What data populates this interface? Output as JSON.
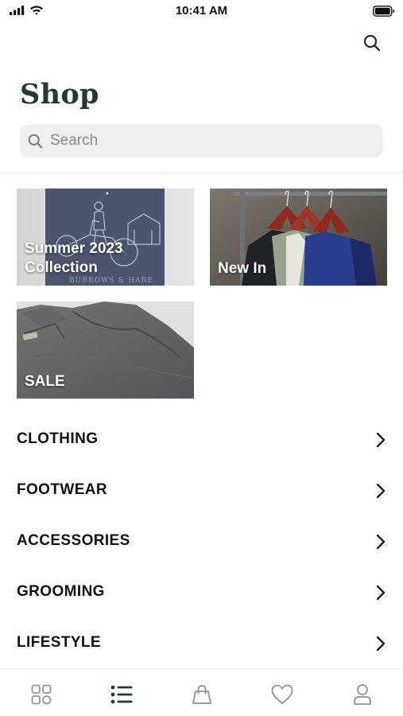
{
  "status_bar": {
    "time": "10:41 AM",
    "icons": [
      "cellular-signal-icon",
      "wifi-icon",
      "battery-icon"
    ]
  },
  "header": {
    "title": "Shop",
    "search_button_icon": "search-icon"
  },
  "search": {
    "placeholder": "Search",
    "value": ""
  },
  "featured_tiles": [
    {
      "label_line1": "Summer 2023",
      "label_line2": "Collection"
    },
    {
      "label": "New In"
    },
    {
      "label": "SALE"
    }
  ],
  "categories": [
    {
      "label": "CLOTHING"
    },
    {
      "label": "FOOTWEAR"
    },
    {
      "label": "ACCESSORIES"
    },
    {
      "label": "GROOMING"
    },
    {
      "label": "LIFESTYLE"
    }
  ],
  "tab_bar": {
    "tabs": [
      {
        "icon": "grid-icon",
        "active": false
      },
      {
        "icon": "list-icon",
        "active": true
      },
      {
        "icon": "shopping-bag-icon",
        "active": false
      },
      {
        "icon": "heart-icon",
        "active": false
      },
      {
        "icon": "profile-icon",
        "active": false
      }
    ]
  },
  "colors": {
    "title": "#223a30",
    "tab_active": "#223a30",
    "tab_inactive": "#8a9590",
    "search_bg": "#efefef"
  }
}
